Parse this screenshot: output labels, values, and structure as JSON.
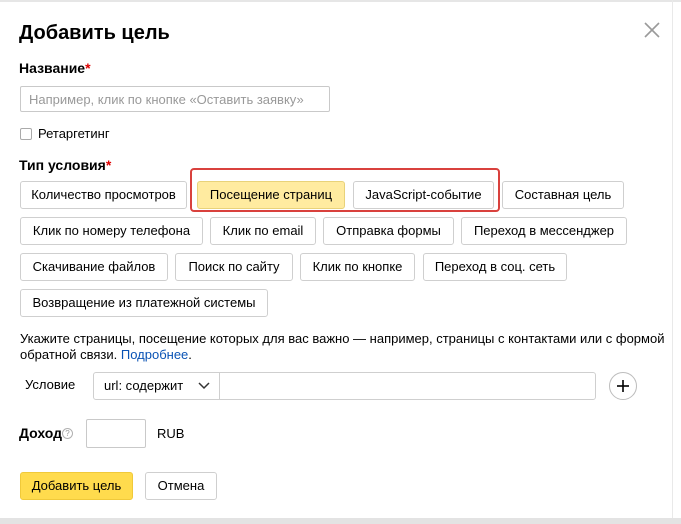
{
  "dialog": {
    "title": "Добавить цель",
    "close_icon": "close-icon"
  },
  "name_field": {
    "label": "Название",
    "required_mark": "*",
    "placeholder": "Например, клик по кнопке «Оставить заявку»",
    "value": ""
  },
  "retargeting": {
    "label": "Ретаргетинг",
    "checked": false
  },
  "condition_type": {
    "label": "Тип условия",
    "required_mark": "*",
    "selected": "Посещение страниц",
    "options": [
      "Количество просмотров",
      "Посещение страниц",
      "JavaScript-событие",
      "Составная цель",
      "Клик по номеру телефона",
      "Клик по email",
      "Отправка формы",
      "Переход в мессенджер",
      "Скачивание файлов",
      "Поиск по сайту",
      "Клик по кнопке",
      "Переход в соц. сеть",
      "Возвращение из платежной системы"
    ]
  },
  "hint": {
    "text": "Укажите страницы, посещение которых для вас важно — например, страницы с контактами или с формой обратной связи.",
    "link": "Подробнее",
    "end": "."
  },
  "condition": {
    "label": "Условие",
    "match_type": "url: содержит",
    "value": "",
    "add_icon": "plus-icon"
  },
  "income": {
    "label": "Доход",
    "help_icon": "question-icon",
    "help_glyph": "?",
    "value": "",
    "currency": "RUB"
  },
  "footer": {
    "submit_label": "Добавить цель",
    "cancel_label": "Отмена"
  },
  "colors": {
    "primary_button": "#ffdb4d",
    "selected_option": "#ffeba0",
    "highlight_frame": "#d9413d",
    "link": "#0a53b5",
    "required": "#dd0000"
  }
}
